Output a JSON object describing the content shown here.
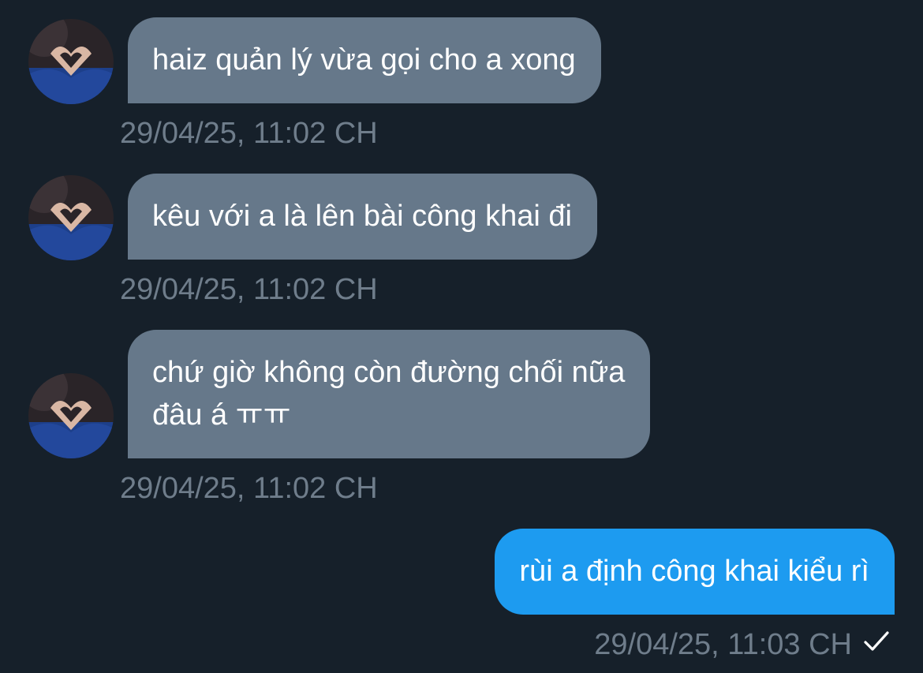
{
  "messages": [
    {
      "direction": "incoming",
      "text": "haiz quản lý vừa gọi cho a xong",
      "timestamp": "29/04/25, 11:02 CH"
    },
    {
      "direction": "incoming",
      "text": "kêu với a là lên bài công khai đi",
      "timestamp": "29/04/25, 11:02 CH"
    },
    {
      "direction": "incoming",
      "lines": [
        "chứ giờ không còn đường chối nữa",
        "đâu á ㅠㅠ"
      ],
      "timestamp": "29/04/25, 11:02 CH"
    },
    {
      "direction": "outgoing",
      "text": "rùi a định công khai kiểu rì",
      "timestamp": "29/04/25, 11:03 CH",
      "status_icon": "check-icon"
    }
  ],
  "colors": {
    "background": "#16202a",
    "incoming_bubble": "#66788a",
    "outgoing_bubble": "#1d9bf0",
    "timestamp": "#6f7d8b"
  }
}
